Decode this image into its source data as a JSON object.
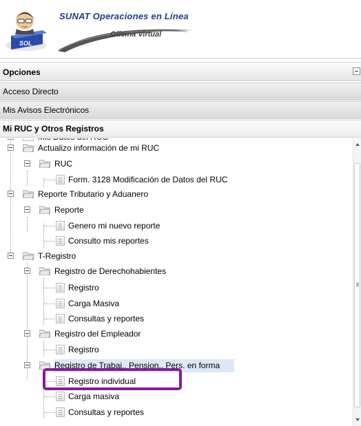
{
  "header": {
    "title": "SUNAT Operaciones en Línea",
    "subtitle": "Oficina Virtual",
    "logo_badge": "SOL"
  },
  "panel": {
    "opciones": "Opciones",
    "acceso_directo": "Acceso Directo",
    "mis_avisos": "Mis Avisos Electrónicos",
    "mi_ruc": "Mi RUC y Otros Registros"
  },
  "tree": {
    "clipped_top": "Mis Datos del RUC",
    "items": [
      "Actualizo información de mi RUC",
      "RUC",
      "Form. 3128 Modificación de Datos del RUC",
      "Reporte Tributario y Aduanero",
      "Reporte",
      "Genero mi nuevo reporte",
      "Consulto mis reportes",
      "T-Registro",
      "Registro de Derechohabientes",
      "Registro",
      "Carga Masiva",
      "Consultas y reportes",
      "Registro del Empleador",
      "Registro",
      "Registro de Trabaj., Pension., Pers. en forma",
      "Registro individual",
      "Carga masiva",
      "Consultas y reportes"
    ]
  },
  "colors": {
    "accent": "#1d3d8f",
    "highlight": "#8b1a9c",
    "selection": "#dde8f6"
  }
}
